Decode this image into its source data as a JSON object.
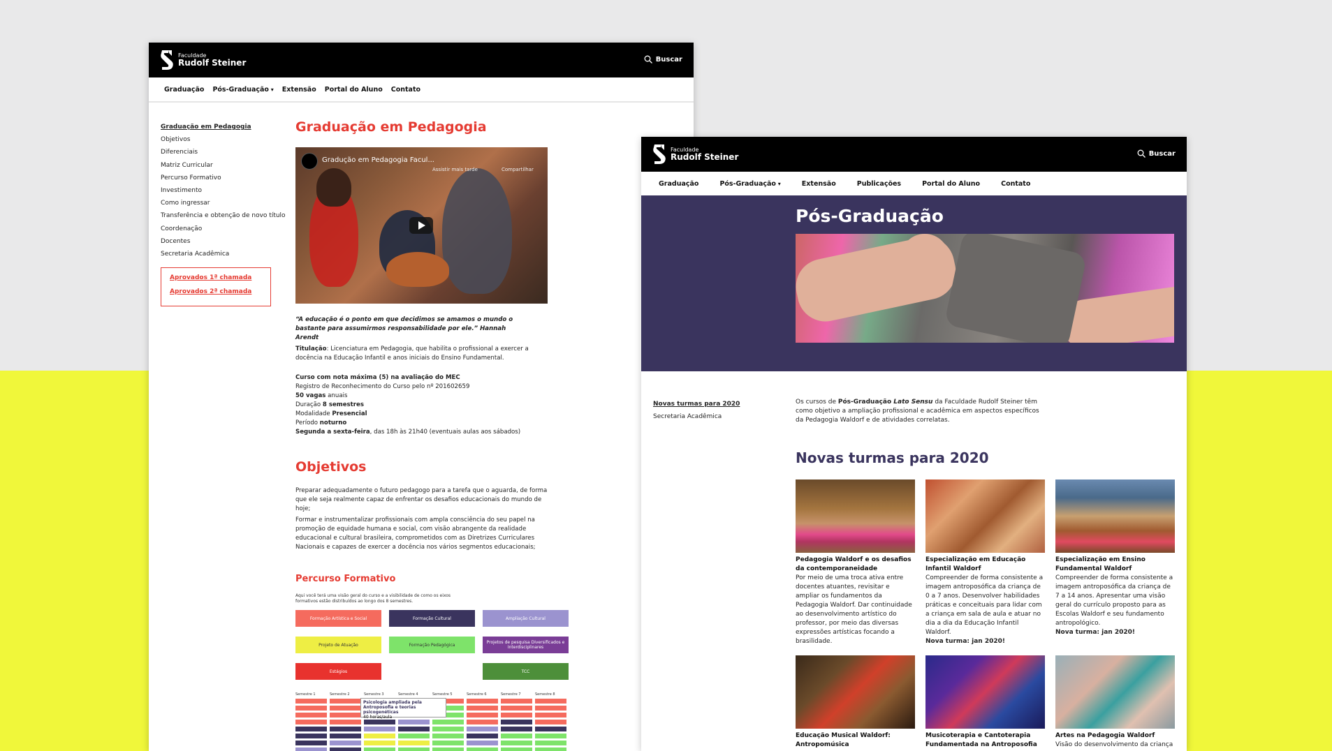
{
  "win1": {
    "logo": {
      "small": "Faculdade",
      "big": "Rudolf Steiner"
    },
    "search_label": "Buscar",
    "nav": [
      "Graduação",
      "Pós-Graduação",
      "Extensão",
      "Portal do Aluno",
      "Contato"
    ],
    "sidebar": [
      "Graduação em Pedagogia",
      "Objetivos",
      "Diferenciais",
      "Matriz Curricular",
      "Percurso Formativo",
      "Investimento",
      "Como ingressar",
      "Transferência e obtenção de novo título",
      "Coordenação",
      "Docentes",
      "Secretaria Acadêmica"
    ],
    "approved": [
      "Aprovados 1ª chamada",
      "Aprovados 2ª chamada"
    ],
    "title": "Graduação em Pedagogia",
    "video": {
      "title": "Gradução em Pedagogia Facul...",
      "watch_later": "Assistir mais tarde",
      "share": "Compartilhar"
    },
    "quote": "“A educação é o ponto em que decidimos se amamos o mundo o bastante para assumirmos responsabilidade por ele.” Hannah Arendt",
    "titulacao_label": "Titulação",
    "titulacao_text": ": Licenciatura em Pedagogia, que habilita o profissional a exercer a docência na Educação Infantil e anos iniciais do Ensino Fundamental.",
    "facts": {
      "mec": "Curso com nota máxima (5) na avaliação do MEC",
      "registro": "Registro de Reconhecimento do Curso pelo nº 201602659",
      "vagas_b": "50 vagas",
      "vagas": " anuais",
      "duracao": "Duração ",
      "duracao_b": "8 semestres",
      "modalidade": "Modalidade ",
      "modalidade_b": "Presencial",
      "periodo": "Período ",
      "periodo_b": "noturno",
      "dias_b": "Segunda a sexta-feira",
      "dias": ", das 18h às 21h40  (eventuais aulas aos sábados)"
    },
    "objetivos_title": "Objetivos",
    "obj_p1": "Preparar adequadamente o futuro pedagogo para a tarefa que o aguarda, de forma que ele seja realmente capaz de enfrentar os desafios educacionais do mundo de hoje;",
    "obj_p2": "Formar e instrumentalizar profissionais com ampla consciência do seu papel na promoção de equidade humana e social, com visão abrangente da realidade educacional e cultural brasileira, comprometidos com as Diretrizes Curriculares Nacionais e capazes de exercer a docência nos vários segmentos educacionais;",
    "percurso_title": "Percurso Formativo",
    "percurso_text": "Aqui você terá uma visão geral do curso e a visibilidade de como os eixos formativos estão distribuídos ao longo dos 8 semestres.",
    "legend": [
      {
        "label": "Formação Artística e Social",
        "color": "#f56b5e"
      },
      {
        "label": "Formação Cultural",
        "color": "#3a345e"
      },
      {
        "label": "Ampliação Cultural",
        "color": "#9b93cf"
      },
      {
        "label": "Projeto de Atuação",
        "color": "#eeee44"
      },
      {
        "label": "Formação Pedagógica",
        "color": "#7ee36a"
      },
      {
        "label": "Projetos de pesquisa Diversificados e Interdisciplinares",
        "color": "#7a3d96"
      },
      {
        "label": "Estágios",
        "color": "#e8322e"
      },
      {
        "label": "TCC",
        "color": "#4d8f3a"
      }
    ],
    "semesters": [
      "Semestre 1",
      "Semestre 2",
      "Semestre 3",
      "Semestre 4",
      "Semestre 5",
      "Semestre 6",
      "Semestre 7",
      "Semestre 8"
    ],
    "tooltip": {
      "title": "Psicologia ampliada pela Antroposofia e teorias psicogenéticas",
      "hours": "40 horas/aula"
    }
  },
  "win2": {
    "logo": {
      "small": "Faculdade",
      "big": "Rudolf Steiner"
    },
    "search_label": "Buscar",
    "nav": [
      "Graduação",
      "Pós-Graduação",
      "Extensão",
      "Publicações",
      "Portal do Aluno",
      "Contato"
    ],
    "hero_title": "Pós-Graduação",
    "sidebar": [
      "Novas turmas para 2020",
      "Secretaria Acadêmica"
    ],
    "intro_a": "Os cursos de ",
    "intro_b": "Pós-Graduação ",
    "intro_c": "Lato Sensu",
    "intro_d": " da Faculdade Rudolf Steiner têm como objetivo a ampliação profissional e acadêmica em aspectos específicos da Pedagogia Waldorf e de atividades correlatas.",
    "novas_title": "Novas turmas para 2020",
    "cards": [
      {
        "title": "Pedagogia Waldorf e os desafios da contemporaneidade",
        "desc": "Por meio de uma troca ativa entre docentes atuantes, revisitar e ampliar os fundamentos da Pedagogia Waldorf. Dar continuidade ao desenvolvimento artístico do professor, por meio das diversas expressões artísticas focando a brasilidade.",
        "note": ""
      },
      {
        "title": "Especialização em Educação Infantil Waldorf",
        "desc": "Compreender de forma consistente a imagem antroposófica da criança de 0 a 7 anos. Desenvolver habilidades práticas e conceituais para lidar com a criança em sala de aula e atuar no dia a dia da Educação Infantil Waldorf.",
        "note": "Nova turma: jan 2020!"
      },
      {
        "title": "Especialização em Ensino Fundamental Waldorf",
        "desc": "Compreender de forma consistente a imagem antroposófica da criança de 7 a 14 anos. Apresentar uma visão geral do currículo proposto para as Escolas Waldorf e seu fundamento antropológico.",
        "note": "Nova turma: jan 2020!"
      },
      {
        "title": "Educação Musical Waldorf: Antropomúsica",
        "desc": "",
        "note": ""
      },
      {
        "title": "Musicoterapia e Cantoterapia Fundamentada na Antroposofia",
        "desc": "",
        "note": ""
      },
      {
        "title": "Artes na Pedagogia Waldorf",
        "desc": "Visão do desenvolvimento da criança e",
        "note": ""
      }
    ]
  },
  "colors": {
    "red": "#e53b32",
    "purple": "#3a345e",
    "yellow": "#f0f73a",
    "gray": "#e9e9ea"
  }
}
